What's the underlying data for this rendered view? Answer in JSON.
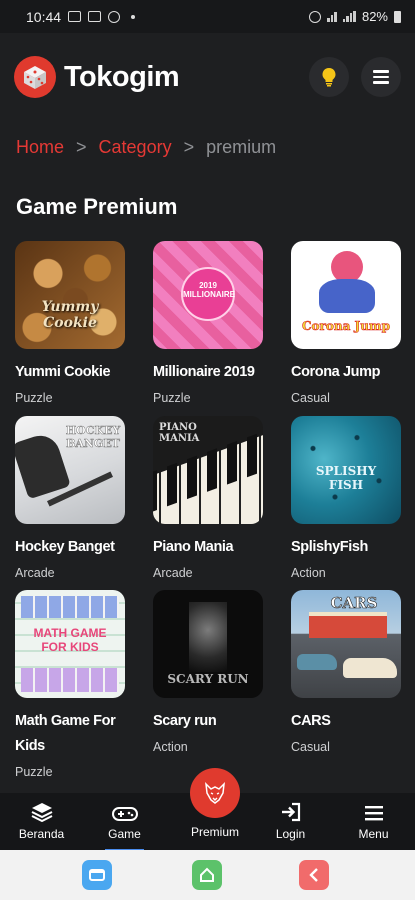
{
  "status_bar": {
    "time": "10:44",
    "battery": "82%"
  },
  "header": {
    "brand": "Tokogim"
  },
  "breadcrumb": {
    "home": "Home",
    "sep1": ">",
    "category": "Category",
    "sep2": ">",
    "current": "premium"
  },
  "page": {
    "title": "Game Premium"
  },
  "games": [
    {
      "name": "Yummi Cookie",
      "category": "Puzzle",
      "thumb_text": "Yummy Cookie"
    },
    {
      "name": "Millionaire 2019",
      "category": "Puzzle",
      "thumb_text": "2019 MILLIONAIRE"
    },
    {
      "name": "Corona Jump",
      "category": "Casual",
      "thumb_text": "Corona Jump"
    },
    {
      "name": "Hockey Banget",
      "category": "Arcade",
      "thumb_text": "HOCKEY BANGET"
    },
    {
      "name": "Piano Mania",
      "category": "Arcade",
      "thumb_text": "PIANO MANIA"
    },
    {
      "name": "SplishyFish",
      "category": "Action",
      "thumb_text": "SPLISHY FISH"
    },
    {
      "name": "Math Game For Kids",
      "category": "Puzzle",
      "thumb_text": "MATH GAME FOR KIDS"
    },
    {
      "name": "Scary run",
      "category": "Action",
      "thumb_text": "SCARY RUN"
    },
    {
      "name": "CARS",
      "category": "Casual",
      "thumb_text": "CARS"
    }
  ],
  "bottom_nav": {
    "home": "Beranda",
    "game": "Game",
    "premium": "Premium",
    "login": "Login",
    "menu": "Menu"
  },
  "colors": {
    "accent": "#e03a2e",
    "background": "#1e1f21",
    "active_indicator": "#4b8ef0"
  }
}
